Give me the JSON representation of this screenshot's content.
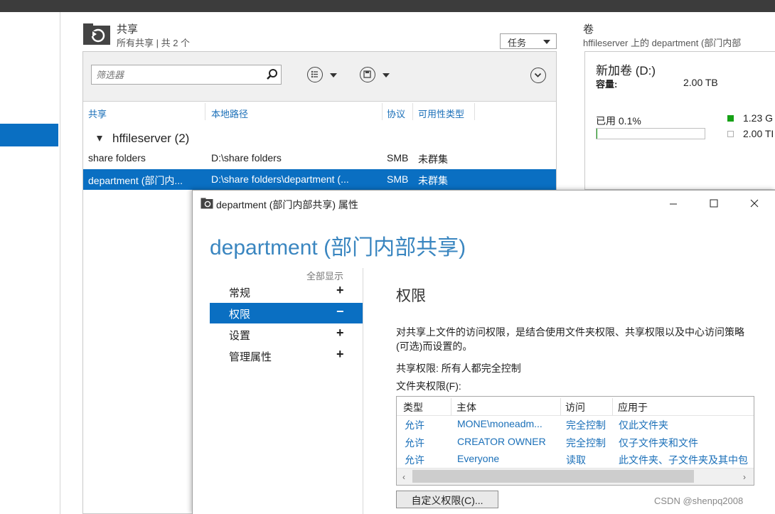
{
  "shares": {
    "title": "共享",
    "subtitle": "所有共享 | 共 2 个",
    "tasks_label": "任务",
    "filter_placeholder": "筛选器",
    "columns": [
      "共享",
      "本地路径",
      "协议",
      "可用性类型"
    ],
    "group_label": "hffileserver (2)",
    "rows": [
      {
        "name": "share folders",
        "path": "D:\\share folders",
        "protocol": "SMB",
        "availability": "未群集"
      },
      {
        "name": "department (部门内...",
        "path": "D:\\share folders\\department (...",
        "protocol": "SMB",
        "availability": "未群集"
      }
    ]
  },
  "volume": {
    "title": "卷",
    "subtitle": "hffileserver 上的 department (部门内部",
    "name": "新加卷 (D:)",
    "capacity_label": "容量:",
    "capacity_value": "2.00 TB",
    "used_label": "已用 0.1%",
    "used_fraction": 0.001,
    "legend": [
      {
        "value": "1.23 G",
        "color": "#16a116"
      },
      {
        "value": "2.00 TI",
        "color": "#ffffff"
      }
    ]
  },
  "dialog": {
    "title": "department (部门内部共享) 属性",
    "big_title": "department (部门内部共享)",
    "show_all": "全部显示",
    "nav": [
      {
        "label": "常规",
        "sign": "+"
      },
      {
        "label": "权限",
        "sign": "−"
      },
      {
        "label": "设置",
        "sign": "+"
      },
      {
        "label": "管理属性",
        "sign": "+"
      }
    ],
    "permissions": {
      "heading": "权限",
      "description": "对共享上文件的访问权限，是结合使用文件夹权限、共享权限以及中心访问策略(可选)而设置的。",
      "share_perm": "共享权限: 所有人都完全控制",
      "folder_perm_label": "文件夹权限(F):",
      "table_headers": [
        "类型",
        "主体",
        "访问",
        "应用于"
      ],
      "table_rows": [
        {
          "type": "允许",
          "principal": "MONE\\moneadm...",
          "access": "完全控制",
          "applies": "仅此文件夹"
        },
        {
          "type": "允许",
          "principal": "CREATOR OWNER",
          "access": "完全控制",
          "applies": "仅子文件夹和文件"
        },
        {
          "type": "允许",
          "principal": "Everyone",
          "access": "读取",
          "applies": "此文件夹、子文件夹及其中包"
        }
      ],
      "custom_button": "自定义权限(C)..."
    }
  },
  "watermark": "CSDN @shenpq2008"
}
